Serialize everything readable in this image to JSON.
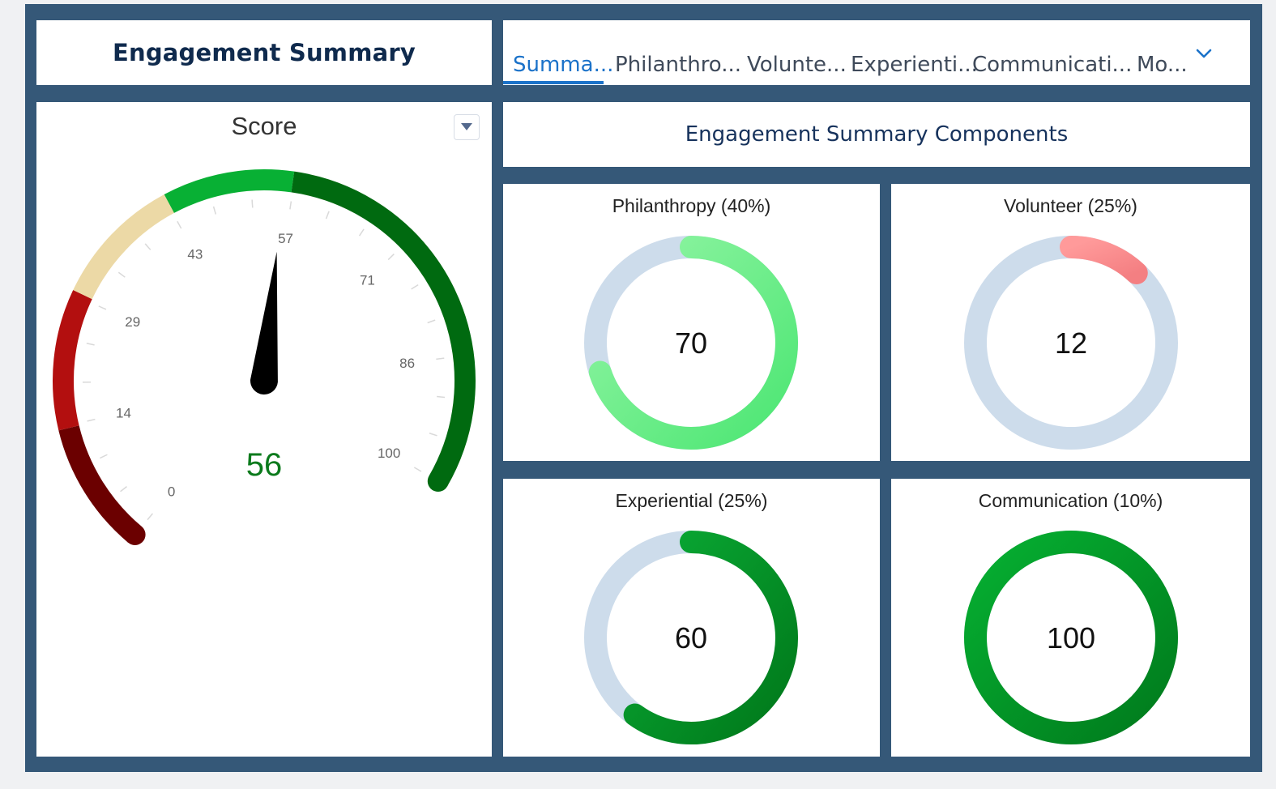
{
  "header": {
    "title": "Engagement Summary"
  },
  "tabs": [
    {
      "label": "Summa...",
      "active": true
    },
    {
      "label": "Philanthro..."
    },
    {
      "label": "Volunte..."
    },
    {
      "label": "Experienti..."
    },
    {
      "label": "Communicati..."
    },
    {
      "label": "Mo..."
    }
  ],
  "gauge": {
    "title": "Score",
    "value": 56,
    "value_label": "56",
    "min": 0,
    "max": 100,
    "ticks": [
      "0",
      "14",
      "29",
      "43",
      "57",
      "71",
      "86",
      "100"
    ],
    "bands": [
      {
        "from": 0,
        "to": 14,
        "color": "#6b0000"
      },
      {
        "from": 14,
        "to": 29,
        "color": "#b30f0f"
      },
      {
        "from": 29,
        "to": 43,
        "color": "#ecd9a6"
      },
      {
        "from": 43,
        "to": 57,
        "color": "#08b034"
      },
      {
        "from": 57,
        "to": 100,
        "color": "#006a10"
      }
    ],
    "value_color": "#0b7a1c"
  },
  "components": {
    "title": "Engagement Summary Components",
    "items": [
      {
        "title": "Philanthropy (40%)",
        "value": 70,
        "value_label": "70",
        "color_start": "#93f5a5",
        "color_end": "#4ce673"
      },
      {
        "title": "Volunteer (25%)",
        "value": 12,
        "value_label": "12",
        "color_start": "#ff9a9a",
        "color_end": "#f47f82"
      },
      {
        "title": "Experiential (25%)",
        "value": 60,
        "value_label": "60",
        "color_start": "#0aaa35",
        "color_end": "#00781a"
      },
      {
        "title": "Communication (10%)",
        "value": 100,
        "value_label": "100",
        "color_start": "#06b032",
        "color_end": "#007a1c"
      }
    ],
    "track_color": "#cddceb"
  },
  "icons": {
    "tab_more": "chevron-down-icon",
    "dropdown": "caret-down-icon"
  }
}
